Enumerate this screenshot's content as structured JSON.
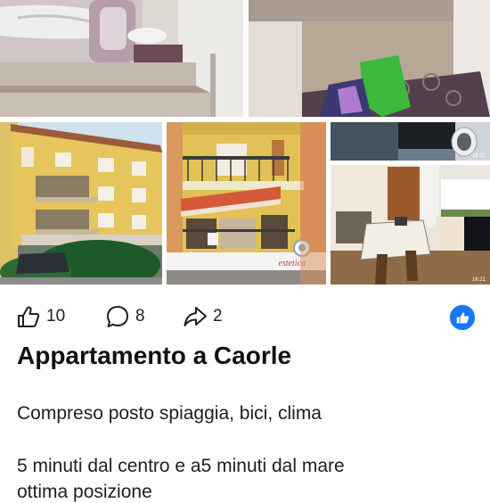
{
  "post": {
    "photos": [
      {
        "name": "bunk-bed-photo"
      },
      {
        "name": "bunk-bed-bags-photo"
      },
      {
        "name": "building-exterior-photo"
      },
      {
        "name": "balcony-awning-photo"
      },
      {
        "name": "bathroom-photo",
        "timestamp": "16:21"
      },
      {
        "name": "dining-kitchen-photo",
        "timestamp": "16:21"
      }
    ],
    "storefront_sign": "estetica",
    "reactions": {
      "like_count": "10",
      "comment_count": "8",
      "share_count": "2"
    },
    "title": "Appartamento a Caorle",
    "description": [
      "Compreso posto spiaggia, bici, clima",
      "5 minuti dal centro e a5 minuti dal mare",
      "ottima posizione"
    ]
  },
  "colors": {
    "accent": "#1877f2",
    "text": "#1c1e21",
    "building_yellow": "#e2c157",
    "awning_red": "#d45a3a"
  },
  "icons": {
    "like": "thumbs-up-icon",
    "comment": "speech-bubble-icon",
    "share": "share-arrow-icon",
    "reaction": "like-reaction-icon"
  }
}
